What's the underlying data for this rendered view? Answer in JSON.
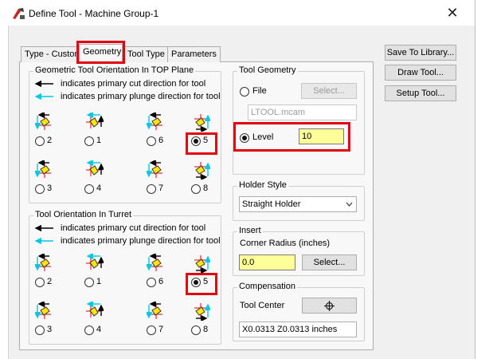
{
  "window": {
    "title": "Define Tool - Machine Group-1",
    "close_glyph": "✕"
  },
  "tabs": [
    {
      "label": "Type - Custom"
    },
    {
      "label": "Geometry"
    },
    {
      "label": "Tool Type"
    },
    {
      "label": "Parameters"
    }
  ],
  "side_buttons": {
    "save": "Save To Library...",
    "draw": "Draw Tool...",
    "setup": "Setup Tool..."
  },
  "geometric_orientation": {
    "title": "Geometric Tool Orientation In TOP Plane",
    "legend_cut": "indicates primary cut direction for tool",
    "legend_plunge": "indicates primary plunge direction for tool",
    "options": [
      "2",
      "1",
      "6",
      "5",
      "3",
      "4",
      "7",
      "8"
    ],
    "selected": "5"
  },
  "turret_orientation": {
    "title": "Tool Orientation In Turret",
    "legend_cut": "indicates primary cut direction for tool",
    "legend_plunge": "indicates primary plunge direction for tool",
    "options": [
      "2",
      "1",
      "6",
      "5",
      "3",
      "4",
      "7",
      "8"
    ],
    "selected": "5"
  },
  "tool_geometry": {
    "title": "Tool Geometry",
    "file_label": "File",
    "select_label": "Select...",
    "file_value": "LTOOL.mcam",
    "level_label": "Level",
    "level_value": "10",
    "selected": "Level"
  },
  "holder_style": {
    "title": "Holder Style",
    "value": "Straight Holder"
  },
  "insert": {
    "title": "Insert",
    "corner_radius_label": "Corner Radius (inches)",
    "corner_radius_value": "0.0",
    "select_label": "Select..."
  },
  "compensation": {
    "title": "Compensation",
    "tool_center_label": "Tool Center",
    "offset_value": "X0.0313 Z0.0313 inches"
  },
  "colors": {
    "highlight": "#e0000f",
    "cut_arrow": "#000000",
    "plunge_arrow": "#00c8e6",
    "insert_fill": "#ffe600",
    "field_yellow": "#ffff99"
  },
  "icons": {
    "app": "define-tool-icon",
    "target": "crosshair-icon",
    "dropdown": "chevron-down-icon"
  }
}
